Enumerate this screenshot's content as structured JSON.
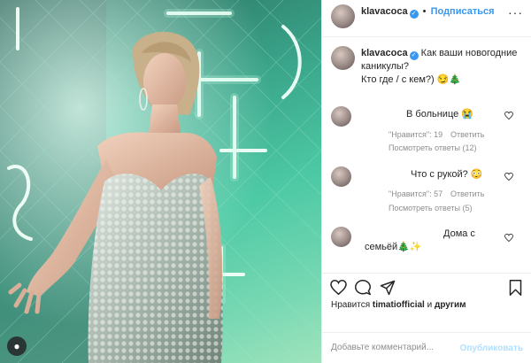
{
  "post": {
    "author": "klavacoca",
    "verified_mark": "✓",
    "separator": "•",
    "follow_label": "Подписаться",
    "more_label": "···",
    "caption_line1": "Как ваши новогодние каникулы?",
    "caption_line2": "Кто где / с кем?) 😏🎄"
  },
  "comments": [
    {
      "text": "В больнице 😭",
      "likes": "\"Нравится\": 19",
      "reply": "Ответить",
      "view_replies": "Посмотреть ответы (12)"
    },
    {
      "text": "Что с рукой? 😳",
      "likes": "\"Нравится\": 57",
      "reply": "Ответить",
      "view_replies": "Посмотреть ответы (5)"
    },
    {
      "text_line1": "Дома с",
      "text_line2": "семьёй🎄✨"
    }
  ],
  "likes": {
    "prefix": "Нравится",
    "user": "timatiofficial",
    "conjunction": "и",
    "others": "другим"
  },
  "comment_box": {
    "placeholder": "Добавьте комментарий...",
    "publish_label": "Опубликовать"
  },
  "photo": {
    "profile_icon": "person-icon",
    "profile_glyph": "●"
  },
  "colors": {
    "accent": "#3897f0",
    "publish_disabled": "#b2dffc",
    "muted": "#8e8e8e",
    "neon": "#4cc9a4"
  },
  "icons": [
    "heart-icon",
    "comment-icon",
    "share-icon",
    "bookmark-icon",
    "verified-icon",
    "more-icon"
  ]
}
